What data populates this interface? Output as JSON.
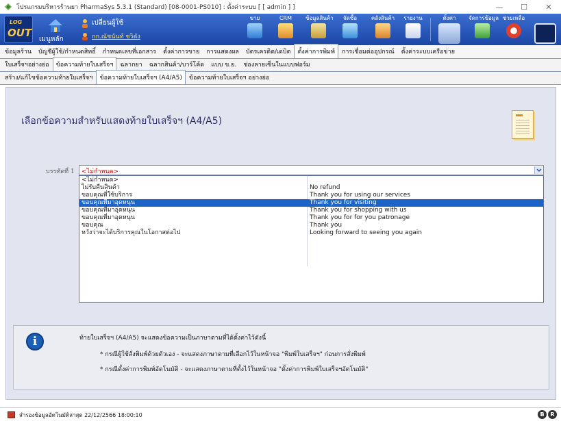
{
  "window": {
    "title": "โปรแกรมบริหารร้านยา PharmaSys 5.3.1 (Standard) [08-0001-PS010] : ตั้งค่าระบบ  [ [ admin ] ]",
    "minimize": "—",
    "maximize": "☐",
    "close": "✕"
  },
  "toolbar": {
    "logout_top": "LOG",
    "logout_bottom": "OUT",
    "home_label": "เมนูหลัก",
    "switch_user": "เปลี่ยนผู้ใช้",
    "user_name": "กก.ณัชนันท์ ชวิตัง",
    "buttons": [
      {
        "label": "ขาย"
      },
      {
        "label": "CRM"
      },
      {
        "label": "ข้อมูลสินค้า"
      },
      {
        "label": "จัดซื้อ"
      },
      {
        "label": "คลังสินค้า"
      },
      {
        "label": "รายงาน"
      },
      {
        "label": "ตั้งค่า"
      },
      {
        "label": "จัดการข้อมูล"
      },
      {
        "label": "ช่วยเหลือ"
      }
    ]
  },
  "menu_tabs": [
    "ข้อมูลร้าน",
    "บัญชีผู้ใช้/กำหนดสิทธิ์",
    "กำหนดเลขที่เอกสาร",
    "ตั้งค่าการขาย",
    "การแสดงผล",
    "บัตรเครดิต/เดบิต",
    "ตั้งค่าการพิมพ์",
    "การเชื่อมต่ออุปกรณ์",
    "ตั้งค่าระบบเครือข่าย"
  ],
  "sub_tabs": [
    "ใบเสร็จฯอย่างย่อ",
    "ข้อความท้ายใบเสร็จฯ",
    "ฉลากยา",
    "ฉลากสินค้า/บาร์โค้ด",
    "แบบ ข.ย.",
    "ช่องลายเซ็นในแบบฟอร์ม"
  ],
  "sub_sub_tabs": [
    "สร้าง/แก้ไขข้อความท้ายใบเสร็จฯ",
    "ข้อความท้ายใบเสร็จฯ (A4/A5)",
    "ข้อความท้ายใบเสร็จฯ อย่างย่อ"
  ],
  "content": {
    "heading": "เลือกข้อความสำหรับแสดงท้ายใบเสร็จฯ (A4/A5)",
    "field_label": "บรรทัดที่ 1",
    "selected_value": "<ไม่กำหนด>",
    "options": [
      {
        "th": "<ไม่กำหนด>",
        "en": ""
      },
      {
        "th": "ไม่รับคืนสินค้า",
        "en": "No refund"
      },
      {
        "th": "ขอบคุณที่ใช้บริการ",
        "en": "Thank you for using our services"
      },
      {
        "th": "ขอบคุณที่มาอุดหนุน",
        "en": "Thank you for visiting"
      },
      {
        "th": "ขอบคุณที่มาอุดหนุน",
        "en": "Thank you for shopping with us"
      },
      {
        "th": "ขอบคุณที่มาอุดหนุน",
        "en": "Thank you for for you patronage"
      },
      {
        "th": "ขอบคุณ",
        "en": "Thank you"
      },
      {
        "th": "หวังว่าจะได้บริการคุณในโอกาสต่อไป",
        "en": "Looking forward to seeing you again"
      }
    ],
    "selected_index": 3
  },
  "info": {
    "main": "ท้ายใบเสร็จฯ (A4/A5) จะแสดงข้อความเป็นภาษาตามที่ได้ตั้งค่าไว้ดังนี้",
    "bullet1": "* กรณีผู้ใช้สั่งพิมพ์ด้วยตัวเอง - จะแสดงภาษาตามที่เลือกไว้ในหน้าจอ \"พิมพ์ใบเสร็จฯ\" ก่อนการสั่งพิมพ์",
    "bullet2": "* กรณีตั้งค่าการพิมพ์อัตโนมัติ - จะแสดงภาษาตามที่ตั้งไว้ในหน้าจอ \"ตั้งค่าการพิมพ์ใบเสร็จฯอัตโนมัติ\""
  },
  "status": {
    "text": "สำรองข้อมูลอัตโนมัติล่าสุด  22/12/2566 18:00:10",
    "badge1": "B",
    "badge2": "R"
  },
  "colors": {
    "toolbar": "#1c46a6",
    "selection": "#1c64c8",
    "panel": "#e2e4ef",
    "heading": "#2d2f6b"
  }
}
